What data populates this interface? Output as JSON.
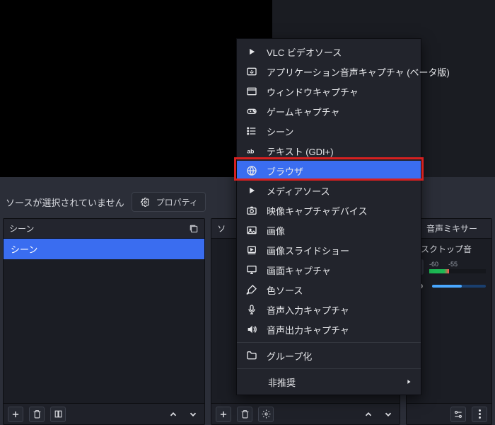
{
  "status": {
    "no_source_selected": "ソースが選択されていません",
    "properties_btn": "プロパティ"
  },
  "docks": {
    "scenes": {
      "title": "シーン",
      "items": [
        "シーン"
      ]
    },
    "sources": {
      "title_trunc": "ソ"
    },
    "mixer": {
      "title": "音声ミキサー",
      "channel_label_trunc": "デスクトップ音",
      "ticks": [
        "-60",
        "-55"
      ]
    }
  },
  "context_menu": {
    "items": [
      {
        "icon": "play",
        "label": "VLC ビデオソース"
      },
      {
        "icon": "app-audio",
        "label": "アプリケーション音声キャプチャ (ベータ版)"
      },
      {
        "icon": "window",
        "label": "ウィンドウキャプチャ"
      },
      {
        "icon": "gamepad",
        "label": "ゲームキャプチャ"
      },
      {
        "icon": "list",
        "label": "シーン"
      },
      {
        "icon": "text",
        "label": "テキスト (GDI+)"
      },
      {
        "icon": "globe",
        "label": "ブラウザ",
        "selected": true
      },
      {
        "icon": "play",
        "label": "メディアソース"
      },
      {
        "icon": "camera",
        "label": "映像キャプチャデバイス"
      },
      {
        "icon": "image",
        "label": "画像"
      },
      {
        "icon": "slideshow",
        "label": "画像スライドショー"
      },
      {
        "icon": "monitor",
        "label": "画面キャプチャ"
      },
      {
        "icon": "brush",
        "label": "色ソース"
      },
      {
        "icon": "mic",
        "label": "音声入力キャプチャ"
      },
      {
        "icon": "speaker",
        "label": "音声出力キャプチャ"
      }
    ],
    "group": {
      "icon": "folder",
      "label": "グループ化"
    },
    "deprecated": {
      "label": "非推奨"
    }
  }
}
